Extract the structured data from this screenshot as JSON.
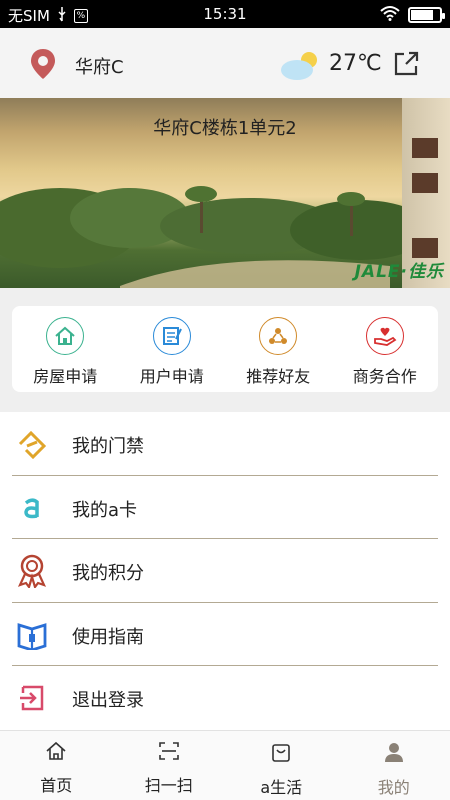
{
  "status_bar": {
    "carrier": "无SIM",
    "time": "15:31"
  },
  "header": {
    "location": "华府C",
    "temperature": "27℃"
  },
  "banner": {
    "title": "华府C楼栋1单元2",
    "logo_text": "JALE·佳乐"
  },
  "quick_actions": [
    {
      "label": "房屋申请",
      "icon": "house-icon",
      "color": "#3bb28f"
    },
    {
      "label": "用户申请",
      "icon": "form-icon",
      "color": "#2a8ad8"
    },
    {
      "label": "推荐好友",
      "icon": "recommend-icon",
      "color": "#d08a2a"
    },
    {
      "label": "商务合作",
      "icon": "cooperation-icon",
      "color": "#d83030"
    }
  ],
  "menu": [
    {
      "label": "我的门禁",
      "icon": "access-card-icon",
      "color": "#e0a52a"
    },
    {
      "label": "我的a卡",
      "icon": "a-card-icon",
      "color": "#3bb9c8"
    },
    {
      "label": "我的积分",
      "icon": "medal-icon",
      "color": "#b54432"
    },
    {
      "label": "使用指南",
      "icon": "guide-book-icon",
      "color": "#2a6fd6"
    },
    {
      "label": "退出登录",
      "icon": "logout-icon",
      "color": "#d84a6a"
    }
  ],
  "tab_bar": {
    "tabs": [
      {
        "label": "首页",
        "icon": "home-icon"
      },
      {
        "label": "扫一扫",
        "icon": "scan-icon"
      },
      {
        "label": "a生活",
        "icon": "shopping-bag-icon"
      },
      {
        "label": "我的",
        "icon": "person-icon"
      }
    ],
    "active": "我的"
  }
}
